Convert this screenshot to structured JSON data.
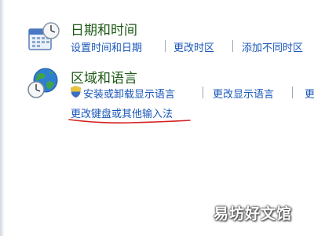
{
  "datetime": {
    "title": "日期和时间",
    "links": [
      "设置时间和日期",
      "更改时区",
      "添加不同时区"
    ]
  },
  "region": {
    "title": "区域和语言",
    "links": [
      "安装或卸载显示语言",
      "更改显示语言",
      "更改键盘或其他输入法"
    ]
  },
  "watermark": "易坊好文馆",
  "colors": {
    "title": "#1e5a16",
    "link": "#1a57b8",
    "annotation": "#d42020"
  }
}
